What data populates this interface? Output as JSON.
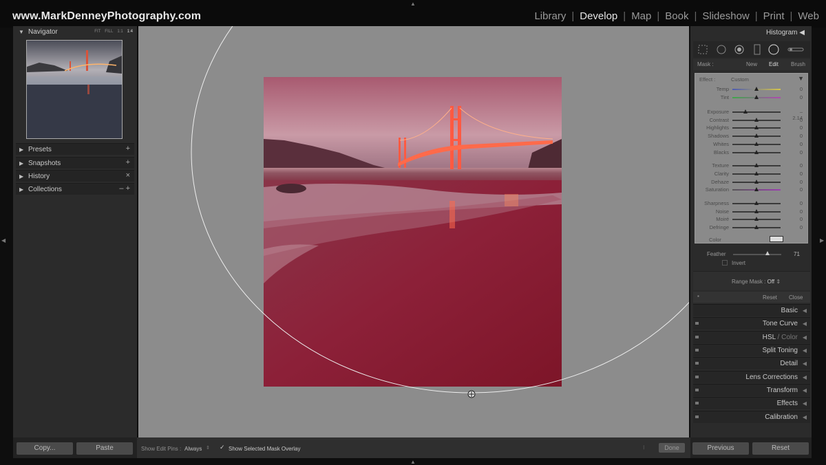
{
  "brand": "www.MarkDenneyPhotography.com",
  "modules": [
    {
      "label": "Library",
      "active": false
    },
    {
      "label": "Develop",
      "active": true
    },
    {
      "label": "Map",
      "active": false
    },
    {
      "label": "Book",
      "active": false
    },
    {
      "label": "Slideshow",
      "active": false
    },
    {
      "label": "Print",
      "active": false
    },
    {
      "label": "Web",
      "active": false
    }
  ],
  "navigator": {
    "title": "Navigator",
    "zoom": [
      "FIT",
      "FILL",
      "1:1",
      "1:4"
    ]
  },
  "left_rows": [
    {
      "label": "Presets",
      "action": "+"
    },
    {
      "label": "Snapshots",
      "action": "+"
    },
    {
      "label": "History",
      "action": "×"
    },
    {
      "label": "Collections",
      "action": "– +"
    }
  ],
  "left_buttons": {
    "copy": "Copy...",
    "paste": "Paste"
  },
  "bottom_bar": {
    "pins_label": "Show Edit Pins :",
    "pins_value": "Always",
    "overlay_label": "Show Selected Mask Overlay",
    "done": "Done"
  },
  "right": {
    "histogram": "Histogram",
    "mask": {
      "label": "Mask :",
      "new": "New",
      "edit": "Edit",
      "brush": "Brush"
    },
    "effect": {
      "label": "Effect :",
      "value": "Custom"
    },
    "sliders": [
      {
        "label": "Temp",
        "value": "0",
        "pos": 0.5
      },
      {
        "label": "Tint",
        "value": "0",
        "pos": 0.5
      },
      {
        "label": "Exposure",
        "value": "– 2.14",
        "pos": 0.27
      },
      {
        "label": "Contrast",
        "value": "0",
        "pos": 0.5
      },
      {
        "label": "Highlights",
        "value": "0",
        "pos": 0.5
      },
      {
        "label": "Shadows",
        "value": "0",
        "pos": 0.5
      },
      {
        "label": "Whites",
        "value": "0",
        "pos": 0.5
      },
      {
        "label": "Blacks",
        "value": "0",
        "pos": 0.5
      },
      {
        "label": "Texture",
        "value": "0",
        "pos": 0.5
      },
      {
        "label": "Clarity",
        "value": "0",
        "pos": 0.5
      },
      {
        "label": "Dehaze",
        "value": "0",
        "pos": 0.5
      },
      {
        "label": "Saturation",
        "value": "0",
        "pos": 0.5
      },
      {
        "label": "Sharpness",
        "value": "0",
        "pos": 0.5
      },
      {
        "label": "Noise",
        "value": "0",
        "pos": 0.5
      },
      {
        "label": "Moiré",
        "value": "0",
        "pos": 0.5
      },
      {
        "label": "Defringe",
        "value": "0",
        "pos": 0.5
      }
    ],
    "color_label": "Color",
    "feather": {
      "label": "Feather",
      "value": "71",
      "pos": 0.71
    },
    "invert": "Invert",
    "range_mask": {
      "label": "Range Mask :",
      "value": "Off"
    },
    "reset": "Reset",
    "close": "Close",
    "sections": [
      {
        "label": "Basic"
      },
      {
        "label": "Tone Curve"
      },
      {
        "label": "HSL",
        "dim": " / Color"
      },
      {
        "label": "Split Toning"
      },
      {
        "label": "Detail"
      },
      {
        "label": "Lens Corrections"
      },
      {
        "label": "Transform"
      },
      {
        "label": "Effects"
      },
      {
        "label": "Calibration"
      }
    ],
    "buttons": {
      "previous": "Previous",
      "reset": "Reset"
    }
  }
}
